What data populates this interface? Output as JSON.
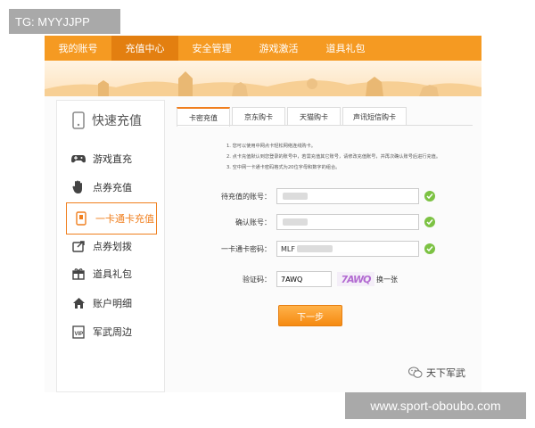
{
  "watermark_top": "TG: MYYJJPP",
  "watermark_bottom": "www.sport-oboubo.com",
  "topnav": {
    "tabs": [
      "我的账号",
      "充值中心",
      "安全管理",
      "游戏激活",
      "道具礼包"
    ],
    "active_index": 1
  },
  "sidebar": {
    "title": "快速充值",
    "items": [
      {
        "label": "游戏直充",
        "icon": "gamepad-icon"
      },
      {
        "label": "点券充值",
        "icon": "hand-icon"
      },
      {
        "label": "一卡通卡充值",
        "icon": "card-icon"
      },
      {
        "label": "点券划拨",
        "icon": "transfer-icon"
      },
      {
        "label": "道具礼包",
        "icon": "gift-icon"
      },
      {
        "label": "账户明细",
        "icon": "home-icon"
      },
      {
        "label": "军武周边",
        "icon": "vip-icon"
      }
    ],
    "active_index": 2
  },
  "subtabs": {
    "items": [
      "卡密充值",
      "京东购卡",
      "天猫购卡",
      "声讯短信购卡"
    ],
    "active_index": 0
  },
  "notes": [
    "1. 您可以使用中网点卡轻松网络连线购卡。",
    "2. 点卡充值默认到您登录的账号中，若需充值其它账号，请修改充值账号，并再次确认账号后进行充值。",
    "3. 空中网一卡通卡密码格式为20位字母和数字的组合。"
  ],
  "form": {
    "account_label": "待充值的账号：",
    "confirm_label": "确认账号：",
    "card_label": "一卡通卡密码：",
    "card_value": "MLF",
    "captcha_label": "验证码：",
    "captcha_value": "7AWQ",
    "captcha_image_text": "7AWQ",
    "refresh_label": "换一张",
    "next_label": "下一步"
  },
  "wechat_brand": "天下军武",
  "colors": {
    "nav": "#f59a22",
    "nav_active": "#e37f10",
    "accent": "#f07f1e",
    "success": "#7cc243"
  }
}
